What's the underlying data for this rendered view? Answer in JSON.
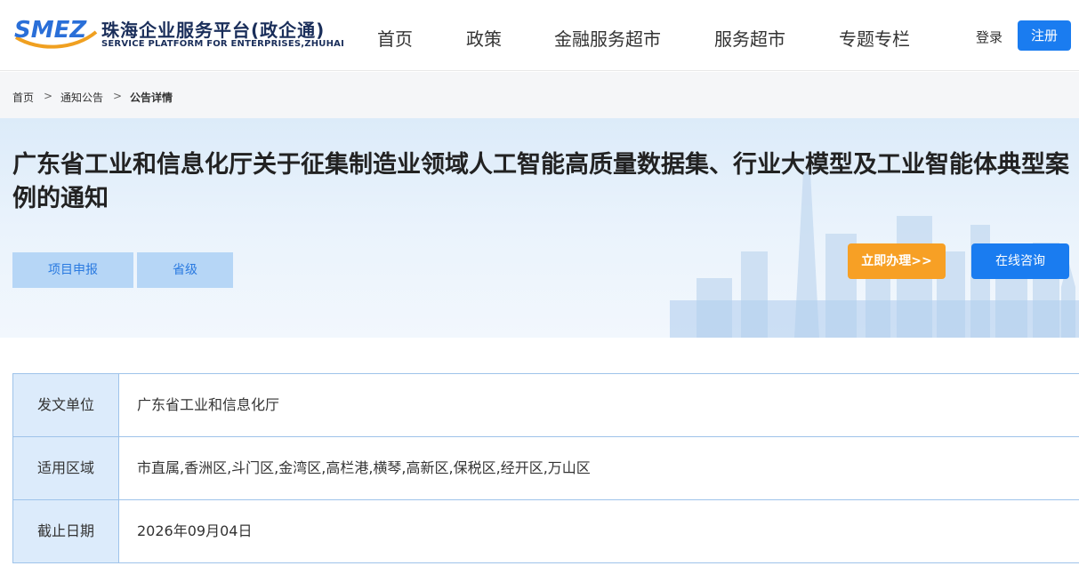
{
  "header": {
    "logo_text": "SMEZ",
    "site_title": "珠海企业服务平台(政企通)",
    "site_subtitle": "SERVICE PLATFORM FOR ENTERPRISES,ZHUHAI",
    "nav": [
      "首页",
      "政策",
      "金融服务超市",
      "服务超市",
      "专题专栏"
    ],
    "login_label": "登录",
    "register_label": "注册"
  },
  "breadcrumb": [
    "首页",
    "通知公告",
    "公告详情"
  ],
  "breadcrumb_separator": ">",
  "notice": {
    "title": "广东省工业和信息化厅关于征集制造业领域人工智能高质量数据集、行业大模型及工业智能体典型案例的通知",
    "tags": [
      "项目申报",
      "省级"
    ],
    "apply_label": "立即办理>>",
    "consult_label": "在线咨询"
  },
  "info": [
    {
      "label": "发文单位",
      "value": "广东省工业和信息化厅"
    },
    {
      "label": "适用区域",
      "value": "市直属,香洲区,斗门区,金湾区,高栏港,横琴,高新区,保税区,经开区,万山区"
    },
    {
      "label": "截止日期",
      "value": "2026年09月04日"
    }
  ],
  "colors": {
    "accent_blue": "#1a7cf0",
    "accent_orange": "#f7a025",
    "tag_bg": "#b6d6f6",
    "banner_bg": "#e4f0fb"
  }
}
